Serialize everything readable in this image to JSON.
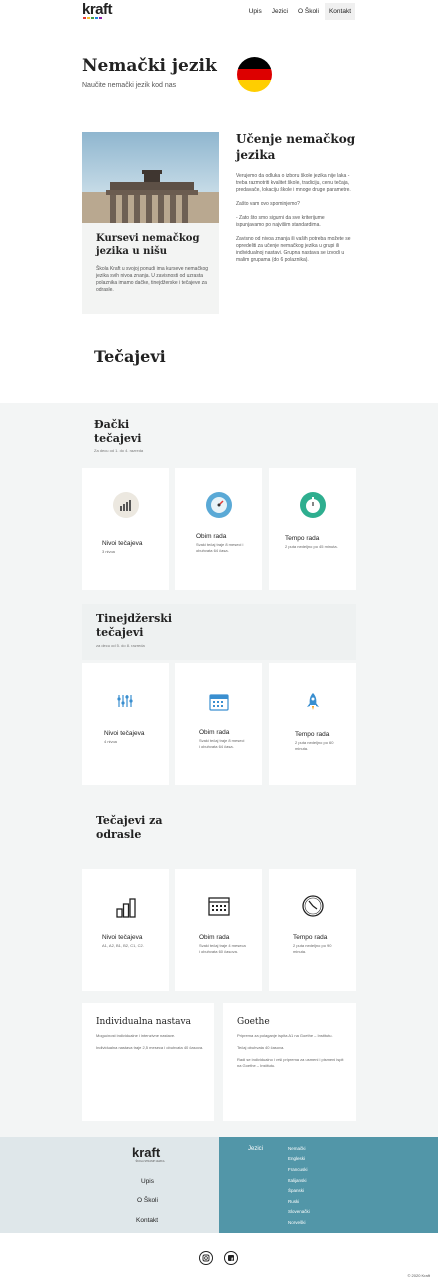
{
  "header": {
    "logo": "kraft",
    "logo_colors": [
      "#e53935",
      "#fbc02d",
      "#43a047",
      "#1e88e5",
      "#8e24aa"
    ],
    "nav": [
      {
        "label": "Upis"
      },
      {
        "label": "Jezici"
      },
      {
        "label": "O Školi"
      },
      {
        "label": "Kontakt"
      }
    ]
  },
  "hero": {
    "title": "Nemački jezik",
    "subtitle": "Naučite nemački jezik kod nas",
    "flag_colors": [
      "#000000",
      "#dd0000",
      "#ffce00"
    ]
  },
  "intro": {
    "left_title": "Kursevi nemačkog jezika u nišu",
    "left_text": "Škola Kraft u svojoj ponudi ima kurseve nemačkog jezika svih nivoa znanja. U zavisnosti od uzrasta polaznika imamo dačke, tinejdžerske i tečajeve za odrasle.",
    "right_title": "Učenje nemačkog jezika",
    "right_text": "Verujemo da odluka o izboru škole jezika nije laka - treba razmotriti kvalitet škole, tradiciju, cenu tečaja, predavače, lokaciju škole i mnoge druge parametre.\n\nZašto vam ovo spominjemo?\n\n- Zato što smo sigurni da sve kriterijume ispunjavamo po najvišim standardima.\n\nZavisno od nivoa znanja ili vaših potreba možete se opredeliti za učenje nemačkog jezika u grupi ili individualnoj nastavi. Grupna nastava se izvodi u malim grupama (do 6 polaznika)."
  },
  "courses_title": "Tečajevi",
  "sections": [
    {
      "title": "Đački tečajevi",
      "subtitle": "Za decu od 1. do 4. razreda",
      "cards": [
        {
          "icon": "bar-chart-icon",
          "title": "Nivoi tečajeva",
          "desc": "3 nivoa"
        },
        {
          "icon": "gauge-icon",
          "title": "Obim rada",
          "desc": "Svaki tečaj traje 8 meseci i obuhvata 64 časa."
        },
        {
          "icon": "stopwatch-icon",
          "title": "Tempo rada",
          "desc": "2 puta nedeljno po 45 minuta."
        }
      ]
    },
    {
      "title": "Tinejdžerski tečajevi",
      "subtitle": "za decu od 5. do 8. razreda",
      "cards": [
        {
          "icon": "sliders-icon",
          "title": "Nivoi tečajeva",
          "desc": "4 nivoa"
        },
        {
          "icon": "calendar-icon",
          "title": "Obim rada",
          "desc": "Svaki tečaj traje 8 meseci i obuhvata 64 časa."
        },
        {
          "icon": "rocket-icon",
          "title": "Tempo rada",
          "desc": "2 puta nedeljno po 60 minuta."
        }
      ]
    },
    {
      "title": "Tečajevi za odrasle",
      "subtitle": "",
      "cards": [
        {
          "icon": "bar-chart-icon",
          "title": "Nivoi tečajeva",
          "desc": "A1, A2, B1, B2, C1, C2."
        },
        {
          "icon": "calendar-icon",
          "title": "Obim rada",
          "desc": "Svaki tečaj traje 4 meseca i obuhvata 60 časova."
        },
        {
          "icon": "clock-icon",
          "title": "Tempo rada",
          "desc": "2 puta nedeljno po 90 minuta."
        }
      ]
    }
  ],
  "individual": {
    "title": "Individualna nastava",
    "text": "Mogućnost individualne i intenzivne nastave.\n\nIndividualna nastava traje 2,5 meseca i obuhvata 40 časova."
  },
  "goethe": {
    "title": "Goethe",
    "text": "Priprema za polaganje ispita A1 na Goethe – Institutu.\n\nTečaj obuhvata 40 časova.\n\nRadi se individualno i vrši priprema za usmeni i pismeni ispit na Goethe – Institutu."
  },
  "footer": {
    "logo": "kraft",
    "tagline": "ŠKOLA STRANIH JEZIKA",
    "links": [
      "Upis",
      "O Školi",
      "Kontakt"
    ],
    "lang_label": "Jezici",
    "languages": [
      "Nemački",
      "Engleski",
      "Francuski",
      "Italijanski",
      "Španski",
      "Ruski",
      "Slovenački",
      "Norveški"
    ],
    "copyright": "© 2020 Kraft"
  }
}
